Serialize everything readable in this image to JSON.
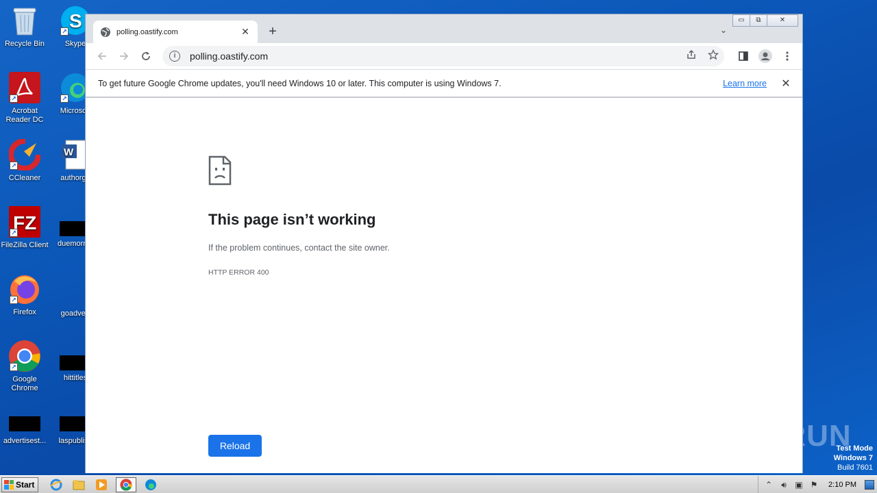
{
  "desktop": {
    "icons": [
      {
        "label": "Recycle Bin"
      },
      {
        "label": "Skype"
      },
      {
        "label": "Acrobat Reader DC"
      },
      {
        "label": "Microsoft"
      },
      {
        "label": "CCleaner"
      },
      {
        "label": "authorgo"
      },
      {
        "label": "FileZilla Client"
      },
      {
        "label": "duemornin"
      },
      {
        "label": "Firefox"
      },
      {
        "label": "goadvert"
      },
      {
        "label": "Google Chrome"
      },
      {
        "label": "hittitles"
      },
      {
        "label": "advertisest..."
      },
      {
        "label": "laspublish"
      }
    ]
  },
  "browser": {
    "tab": {
      "title": "polling.oastify.com",
      "close": "✕"
    },
    "new_tab": "+",
    "tab_search": "⌄",
    "window_controls": {
      "minimize": "▭",
      "restore": "⧉",
      "close": "✕"
    },
    "omnibox": {
      "url": "polling.oastify.com"
    },
    "infobar": {
      "message": "To get future Google Chrome updates, you'll need Windows 10 or later. This computer is using Windows 7.",
      "link": "Learn more",
      "close": "✕"
    },
    "page": {
      "title": "This page isn’t working",
      "subtitle": "If the problem continues, contact the site owner.",
      "error_code": "HTTP ERROR 400",
      "reload_label": "Reload"
    }
  },
  "watermark": "ANY RUN",
  "os_badge": {
    "line1": "Test Mode",
    "line2": "Windows 7",
    "line3": "Build 7601"
  },
  "taskbar": {
    "start_label": "Start",
    "clock": "2:10 PM"
  },
  "colors": {
    "accent": "#1a73e8",
    "desktop": "#0b57b8"
  }
}
